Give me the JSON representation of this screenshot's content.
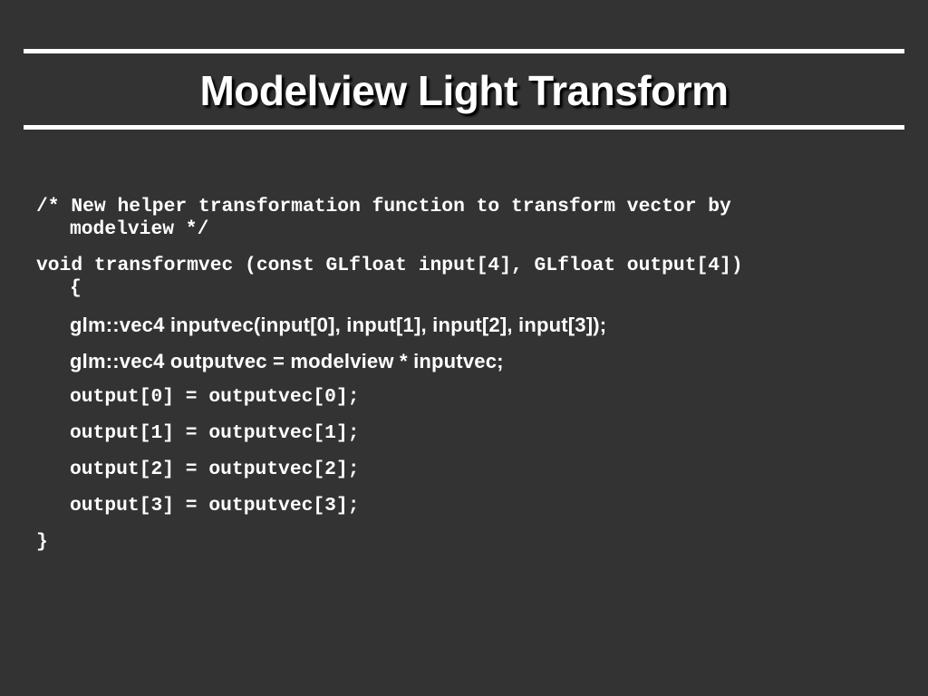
{
  "slide": {
    "title": "Modelview Light Transform",
    "code_lines": [
      {
        "text": "/* New helper transformation function to transform vector by",
        "indent": false
      },
      {
        "text": "modelview */",
        "indent": true
      },
      {
        "text": "void transformvec (const GLfloat input[4], GLfloat output[4])",
        "indent": false
      },
      {
        "text": "{",
        "indent": true
      },
      {
        "text": "glm::vec4 inputvec(input[0], input[1], input[2], input[3]);",
        "indent": true
      },
      {
        "text": "glm::vec4 outputvec = modelview * inputvec;",
        "indent": true
      },
      {
        "text": "output[0] = outputvec[0];",
        "indent": true
      },
      {
        "text": "output[1] = outputvec[1];",
        "indent": true
      },
      {
        "text": "output[2] = outputvec[2];",
        "indent": true
      },
      {
        "text": "output[3] = outputvec[3];",
        "indent": true
      },
      {
        "text": "}",
        "indent": false
      }
    ]
  },
  "colors": {
    "background": "#333333",
    "text": "#ffffff",
    "rules": "#ffffff"
  }
}
